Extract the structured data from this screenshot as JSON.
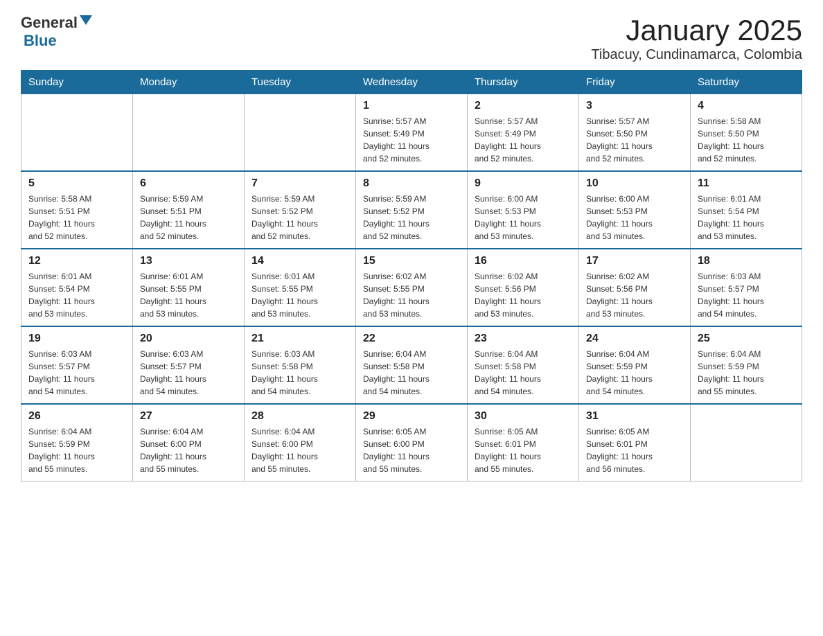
{
  "header": {
    "logo_general": "General",
    "logo_blue": "Blue",
    "title": "January 2025",
    "subtitle": "Tibacuy, Cundinamarca, Colombia"
  },
  "weekdays": [
    "Sunday",
    "Monday",
    "Tuesday",
    "Wednesday",
    "Thursday",
    "Friday",
    "Saturday"
  ],
  "weeks": [
    [
      {
        "day": "",
        "info": ""
      },
      {
        "day": "",
        "info": ""
      },
      {
        "day": "",
        "info": ""
      },
      {
        "day": "1",
        "info": "Sunrise: 5:57 AM\nSunset: 5:49 PM\nDaylight: 11 hours\nand 52 minutes."
      },
      {
        "day": "2",
        "info": "Sunrise: 5:57 AM\nSunset: 5:49 PM\nDaylight: 11 hours\nand 52 minutes."
      },
      {
        "day": "3",
        "info": "Sunrise: 5:57 AM\nSunset: 5:50 PM\nDaylight: 11 hours\nand 52 minutes."
      },
      {
        "day": "4",
        "info": "Sunrise: 5:58 AM\nSunset: 5:50 PM\nDaylight: 11 hours\nand 52 minutes."
      }
    ],
    [
      {
        "day": "5",
        "info": "Sunrise: 5:58 AM\nSunset: 5:51 PM\nDaylight: 11 hours\nand 52 minutes."
      },
      {
        "day": "6",
        "info": "Sunrise: 5:59 AM\nSunset: 5:51 PM\nDaylight: 11 hours\nand 52 minutes."
      },
      {
        "day": "7",
        "info": "Sunrise: 5:59 AM\nSunset: 5:52 PM\nDaylight: 11 hours\nand 52 minutes."
      },
      {
        "day": "8",
        "info": "Sunrise: 5:59 AM\nSunset: 5:52 PM\nDaylight: 11 hours\nand 52 minutes."
      },
      {
        "day": "9",
        "info": "Sunrise: 6:00 AM\nSunset: 5:53 PM\nDaylight: 11 hours\nand 53 minutes."
      },
      {
        "day": "10",
        "info": "Sunrise: 6:00 AM\nSunset: 5:53 PM\nDaylight: 11 hours\nand 53 minutes."
      },
      {
        "day": "11",
        "info": "Sunrise: 6:01 AM\nSunset: 5:54 PM\nDaylight: 11 hours\nand 53 minutes."
      }
    ],
    [
      {
        "day": "12",
        "info": "Sunrise: 6:01 AM\nSunset: 5:54 PM\nDaylight: 11 hours\nand 53 minutes."
      },
      {
        "day": "13",
        "info": "Sunrise: 6:01 AM\nSunset: 5:55 PM\nDaylight: 11 hours\nand 53 minutes."
      },
      {
        "day": "14",
        "info": "Sunrise: 6:01 AM\nSunset: 5:55 PM\nDaylight: 11 hours\nand 53 minutes."
      },
      {
        "day": "15",
        "info": "Sunrise: 6:02 AM\nSunset: 5:55 PM\nDaylight: 11 hours\nand 53 minutes."
      },
      {
        "day": "16",
        "info": "Sunrise: 6:02 AM\nSunset: 5:56 PM\nDaylight: 11 hours\nand 53 minutes."
      },
      {
        "day": "17",
        "info": "Sunrise: 6:02 AM\nSunset: 5:56 PM\nDaylight: 11 hours\nand 53 minutes."
      },
      {
        "day": "18",
        "info": "Sunrise: 6:03 AM\nSunset: 5:57 PM\nDaylight: 11 hours\nand 54 minutes."
      }
    ],
    [
      {
        "day": "19",
        "info": "Sunrise: 6:03 AM\nSunset: 5:57 PM\nDaylight: 11 hours\nand 54 minutes."
      },
      {
        "day": "20",
        "info": "Sunrise: 6:03 AM\nSunset: 5:57 PM\nDaylight: 11 hours\nand 54 minutes."
      },
      {
        "day": "21",
        "info": "Sunrise: 6:03 AM\nSunset: 5:58 PM\nDaylight: 11 hours\nand 54 minutes."
      },
      {
        "day": "22",
        "info": "Sunrise: 6:04 AM\nSunset: 5:58 PM\nDaylight: 11 hours\nand 54 minutes."
      },
      {
        "day": "23",
        "info": "Sunrise: 6:04 AM\nSunset: 5:58 PM\nDaylight: 11 hours\nand 54 minutes."
      },
      {
        "day": "24",
        "info": "Sunrise: 6:04 AM\nSunset: 5:59 PM\nDaylight: 11 hours\nand 54 minutes."
      },
      {
        "day": "25",
        "info": "Sunrise: 6:04 AM\nSunset: 5:59 PM\nDaylight: 11 hours\nand 55 minutes."
      }
    ],
    [
      {
        "day": "26",
        "info": "Sunrise: 6:04 AM\nSunset: 5:59 PM\nDaylight: 11 hours\nand 55 minutes."
      },
      {
        "day": "27",
        "info": "Sunrise: 6:04 AM\nSunset: 6:00 PM\nDaylight: 11 hours\nand 55 minutes."
      },
      {
        "day": "28",
        "info": "Sunrise: 6:04 AM\nSunset: 6:00 PM\nDaylight: 11 hours\nand 55 minutes."
      },
      {
        "day": "29",
        "info": "Sunrise: 6:05 AM\nSunset: 6:00 PM\nDaylight: 11 hours\nand 55 minutes."
      },
      {
        "day": "30",
        "info": "Sunrise: 6:05 AM\nSunset: 6:01 PM\nDaylight: 11 hours\nand 55 minutes."
      },
      {
        "day": "31",
        "info": "Sunrise: 6:05 AM\nSunset: 6:01 PM\nDaylight: 11 hours\nand 56 minutes."
      },
      {
        "day": "",
        "info": ""
      }
    ]
  ]
}
